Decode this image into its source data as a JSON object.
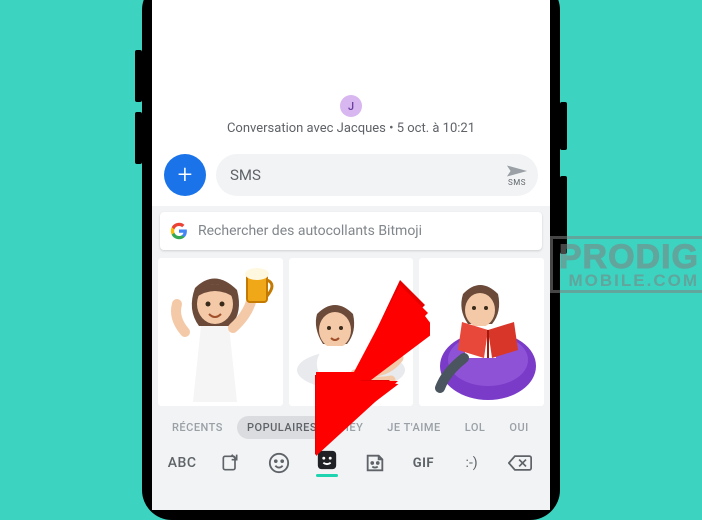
{
  "conversation": {
    "avatar_initial": "J",
    "info_text": "Conversation avec Jacques • 5 oct. à 10:21"
  },
  "compose": {
    "add_icon": "plus-icon",
    "placeholder": "SMS",
    "send_label": "SMS"
  },
  "keyboard": {
    "search_placeholder": "Rechercher des autocollants Bitmoji",
    "stickers": [
      {
        "name": "bitmoji-cheers-beer"
      },
      {
        "name": "bitmoji-lying-down"
      },
      {
        "name": "bitmoji-reading-beanbag"
      }
    ],
    "categories": [
      {
        "label": "RÉCENTS",
        "active": false
      },
      {
        "label": "POPULAIRES",
        "active": true
      },
      {
        "label": "HEY",
        "active": false
      },
      {
        "label": "JE T'AIME",
        "active": false
      },
      {
        "label": "LOL",
        "active": false
      },
      {
        "label": "OUI",
        "active": false
      }
    ],
    "bottom_bar": {
      "abc_label": "ABC",
      "gif_label": "GIF",
      "text_emote": ":-)"
    }
  },
  "watermark": {
    "line1": "PRODIG",
    "line2": "MOBILE.COM"
  }
}
